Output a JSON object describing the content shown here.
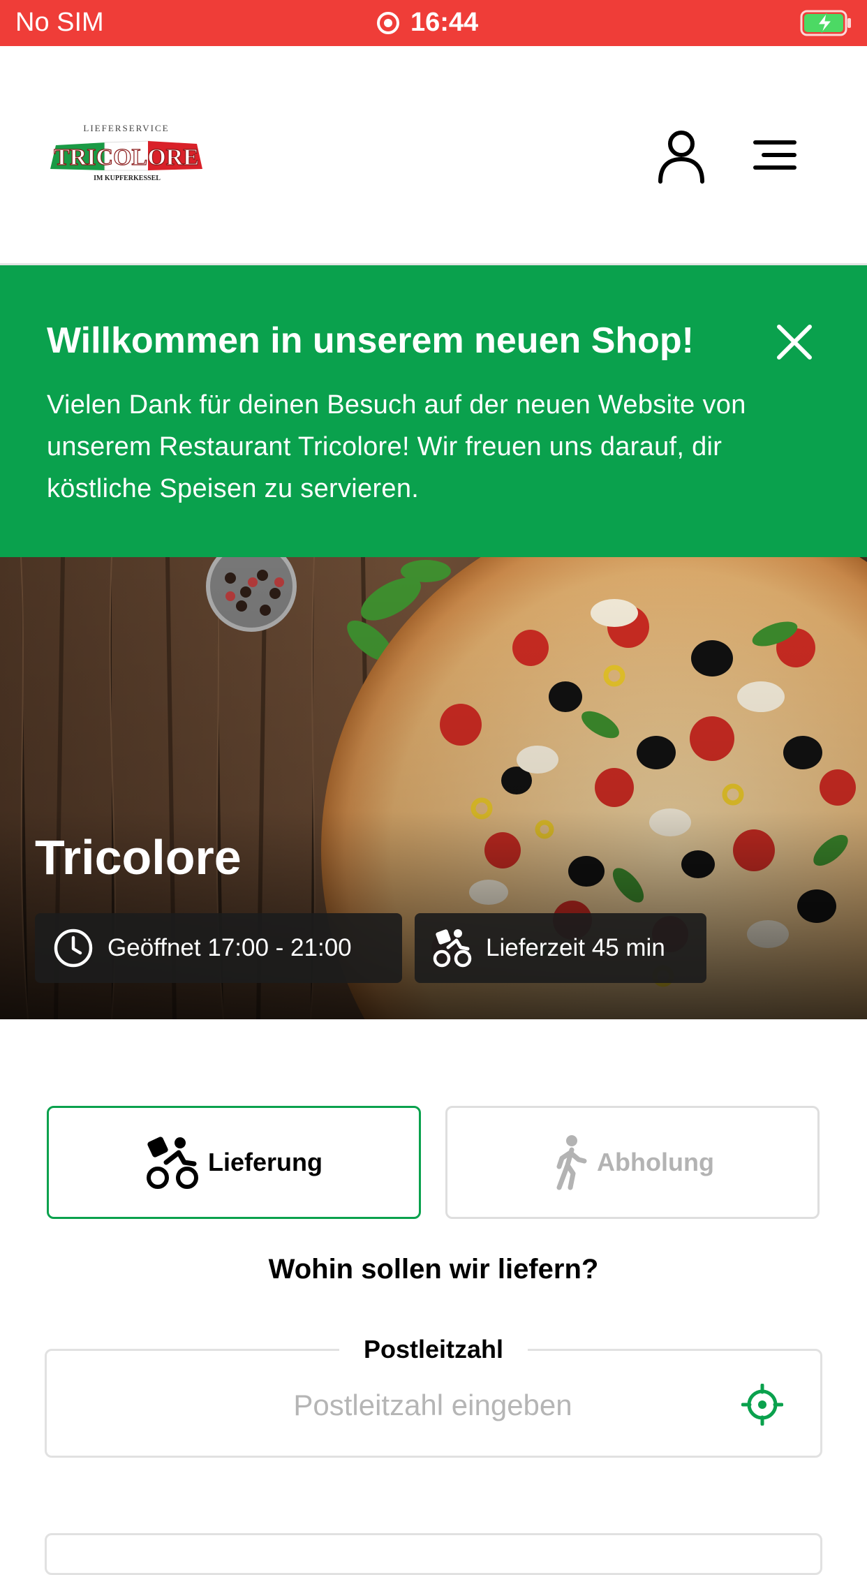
{
  "status_bar": {
    "carrier": "No SIM",
    "time": "16:44"
  },
  "header": {
    "logo": {
      "top_text": "LIEFERSERVICE",
      "brand": "TRICOLORE",
      "sub_text": "IM KUPFERKESSEL"
    }
  },
  "banner": {
    "title": "Willkommen in unserem neuen Shop!",
    "text": "Vielen Dank für deinen Besuch auf der neuen Website von unserem Restaurant Tricolore! Wir freuen uns darauf, dir köstliche Speisen zu servieren.",
    "color": "#0aa14d"
  },
  "hero": {
    "restaurant_name": "Tricolore",
    "opening_hours": "Geöffnet 17:00 - 21:00",
    "delivery_time": "Lieferzeit 45 min"
  },
  "order_mode": {
    "delivery_label": "Lieferung",
    "pickup_label": "Abholung",
    "selected": "Lieferung"
  },
  "address": {
    "question": "Wohin sollen wir liefern?",
    "postcode_label": "Postleitzahl",
    "postcode_placeholder": "Postleitzahl eingeben",
    "postcode_value": ""
  },
  "colors": {
    "status_bar": "#ef3d38",
    "accent": "#0aa14d"
  }
}
